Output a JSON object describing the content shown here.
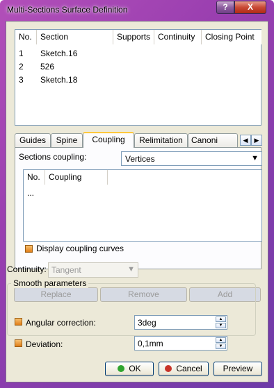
{
  "window": {
    "title": "Multi-Sections Surface Definition",
    "help_glyph": "?",
    "close_glyph": "X"
  },
  "sections": {
    "columns": [
      "No.",
      "Section",
      "Supports",
      "Continuity",
      "Closing Point"
    ],
    "rows": [
      {
        "no": "1",
        "section": "Sketch.16"
      },
      {
        "no": "2",
        "section": "526"
      },
      {
        "no": "3",
        "section": "Sketch.18"
      }
    ]
  },
  "tabs": {
    "items": [
      "Guides",
      "Spine",
      "Coupling",
      "Relimitation",
      "Canoni"
    ],
    "active": "Coupling",
    "scroll_left": "◀",
    "scroll_right": "▶"
  },
  "coupling": {
    "label": "Sections coupling:",
    "selected": "Vertices",
    "list_columns": [
      "No.",
      "Coupling"
    ],
    "list_rows": [
      "..."
    ],
    "display_label": "Display coupling curves"
  },
  "actions": {
    "replace": "Replace",
    "remove": "Remove",
    "add": "Add"
  },
  "continuity": {
    "label": "Continuity:",
    "value": "Tangent"
  },
  "smooth": {
    "title": "Smooth parameters",
    "angular_label": "Angular correction:",
    "angular_value": "3deg",
    "deviation_label": "Deviation:",
    "deviation_value": "0,1mm"
  },
  "buttons": {
    "ok": "OK",
    "cancel": "Cancel",
    "preview": "Preview"
  },
  "colors": {
    "ok_dot": "#2fa52f",
    "cancel_dot": "#c8342a",
    "checkbox": "#e07d17",
    "active_tab_accent": "#ffc83c"
  }
}
